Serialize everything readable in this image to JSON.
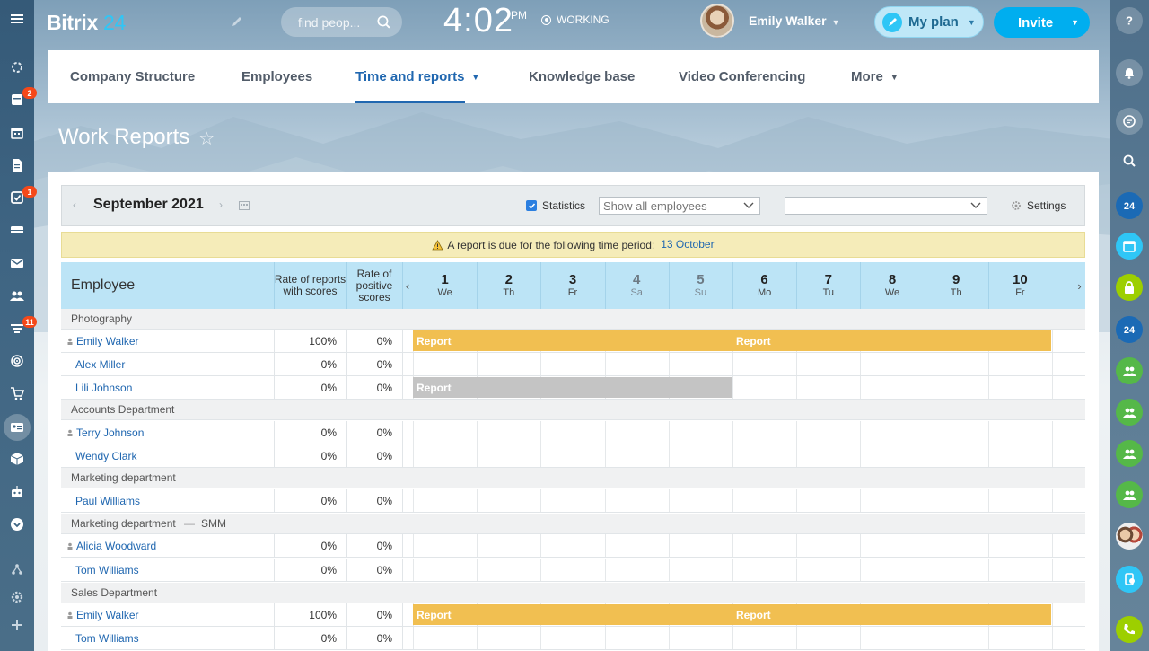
{
  "app": {
    "logo_main": "Bitrix",
    "logo_num": "24"
  },
  "header": {
    "search_placeholder": "find peop...",
    "clock_time": "4:02",
    "clock_ampm": "PM",
    "status": "WORKING",
    "user_name": "Emily Walker",
    "myplan_label": "My plan",
    "invite_label": "Invite"
  },
  "nav": {
    "tabs": [
      {
        "label": "Company Structure"
      },
      {
        "label": "Employees"
      },
      {
        "label": "Time and reports"
      },
      {
        "label": "Knowledge base"
      },
      {
        "label": "Video Conferencing"
      },
      {
        "label": "More"
      }
    ]
  },
  "page": {
    "title": "Work Reports"
  },
  "toolbar": {
    "month": "September 2021",
    "statistics_label": "Statistics",
    "employees_filter": "Show all employees",
    "second_filter": "",
    "settings_label": "Settings"
  },
  "notice": {
    "text": "A report is due for the following time period:",
    "link": "13 October"
  },
  "table": {
    "col_employee": "Employee",
    "col_rate_scores": "Rate of reports with scores",
    "col_rate_positive": "Rate of positive scores",
    "days": [
      {
        "num": "1",
        "wd": "We"
      },
      {
        "num": "2",
        "wd": "Th"
      },
      {
        "num": "3",
        "wd": "Fr"
      },
      {
        "num": "4",
        "wd": "Sa"
      },
      {
        "num": "5",
        "wd": "Su"
      },
      {
        "num": "6",
        "wd": "Mo"
      },
      {
        "num": "7",
        "wd": "Tu"
      },
      {
        "num": "8",
        "wd": "We"
      },
      {
        "num": "9",
        "wd": "Th"
      },
      {
        "num": "10",
        "wd": "Fr"
      }
    ],
    "report_label": "Report",
    "sections": [
      {
        "label": "Photography",
        "sub": ""
      },
      {
        "label": "Accounts Department",
        "sub": ""
      },
      {
        "label": "Marketing department",
        "sub": ""
      },
      {
        "label": "Marketing department",
        "sub": "SMM"
      },
      {
        "label": "Sales Department",
        "sub": ""
      }
    ],
    "rows": [
      {
        "name": "Emily Walker",
        "rate": "100%",
        "positive": "0%",
        "head": true
      },
      {
        "name": "Alex Miller",
        "rate": "0%",
        "positive": "0%",
        "head": false
      },
      {
        "name": "Lili Johnson",
        "rate": "0%",
        "positive": "0%",
        "head": false
      },
      {
        "name": "Terry Johnson",
        "rate": "0%",
        "positive": "0%",
        "head": true
      },
      {
        "name": "Wendy Clark",
        "rate": "0%",
        "positive": "0%",
        "head": false
      },
      {
        "name": "Paul Williams",
        "rate": "0%",
        "positive": "0%",
        "head": false
      },
      {
        "name": "Alicia Woodward",
        "rate": "0%",
        "positive": "0%",
        "head": true
      },
      {
        "name": "Tom Williams",
        "rate": "0%",
        "positive": "0%",
        "head": false
      },
      {
        "name": "Emily Walker",
        "rate": "100%",
        "positive": "0%",
        "head": true
      },
      {
        "name": "Tom Williams",
        "rate": "0%",
        "positive": "0%",
        "head": false
      }
    ]
  },
  "badges": {
    "tasks": "2",
    "checklist": "1",
    "feed": "11"
  },
  "colors": {
    "accent": "#2067b0",
    "invite": "#00aeef",
    "report_bar": "#f1bf51",
    "report_bar_grey": "#c4c4c4",
    "header_row": "#bce4f6"
  }
}
